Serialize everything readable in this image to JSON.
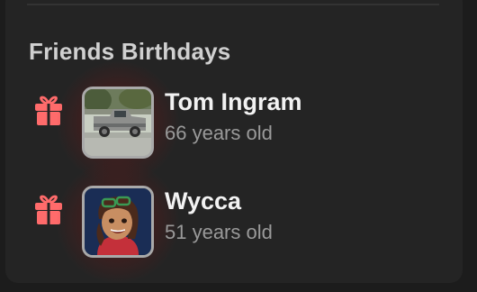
{
  "section": {
    "title": "Friends Birthdays"
  },
  "friends": [
    {
      "name": "Tom Ingram",
      "age": "66 years old",
      "icon": "gift-icon",
      "avatar": "truck-photo"
    },
    {
      "name": "Wycca",
      "age": "51 years old",
      "icon": "gift-icon",
      "avatar": "cartoon-portrait"
    }
  ],
  "colors": {
    "panel_bg": "#242424",
    "gift_icon": "#ff6b6b",
    "avatar_border": "#a9a9a9",
    "glow": "#961919"
  }
}
